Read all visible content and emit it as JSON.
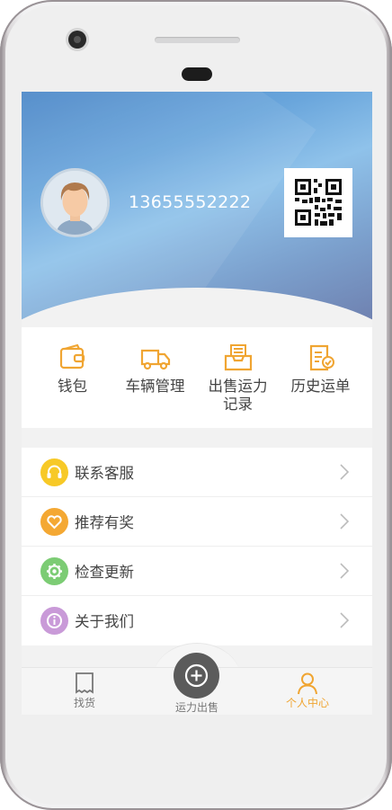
{
  "profile": {
    "phone_number": "13655552222"
  },
  "quick_actions": [
    {
      "label": "钱包",
      "icon": "wallet-icon"
    },
    {
      "label": "车辆管理",
      "icon": "truck-icon"
    },
    {
      "label": "出售运力记录",
      "icon": "inbox-tray-icon"
    },
    {
      "label": "历史运单",
      "icon": "document-check-icon"
    }
  ],
  "menu": [
    {
      "label": "联系客服",
      "icon": "headset-icon",
      "color": "#f7c927"
    },
    {
      "label": "推荐有奖",
      "icon": "heart-icon",
      "color": "#f4a833"
    },
    {
      "label": "检查更新",
      "icon": "gear-icon",
      "color": "#7ccc74"
    },
    {
      "label": "关于我们",
      "icon": "info-icon",
      "color": "#c99ad8"
    }
  ],
  "tabbar": {
    "find_goods": "找货",
    "sell_capacity": "运力出售",
    "personal_center": "个人中心"
  },
  "colors": {
    "accent": "#f0a532",
    "tab_inactive": "#777777"
  }
}
